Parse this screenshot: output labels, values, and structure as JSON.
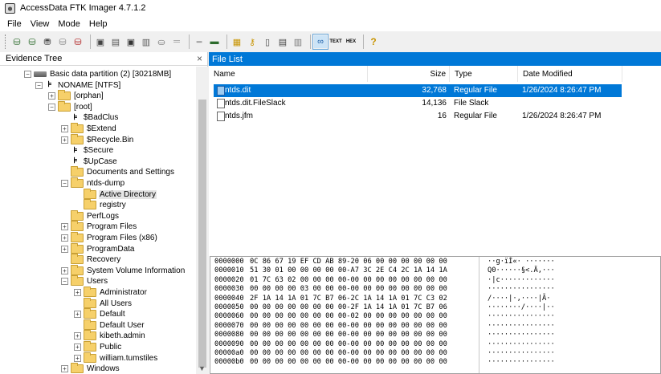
{
  "window": {
    "title": "AccessData FTK Imager 4.7.1.2"
  },
  "menu": [
    "File",
    "View",
    "Mode",
    "Help"
  ],
  "toolbar": {
    "icons": [
      "add-evidence-icon",
      "add-all-evidence-icon",
      "image-mounting-icon",
      "remove-evidence-icon",
      "remove-all-evidence-icon",
      "create-disk-image-icon",
      "export-disk-image-icon",
      "export-logical-image-icon",
      "add-to-custom-image-icon",
      "create-custom-image-icon",
      "decrypt-icon",
      "verify-drive-icon",
      "capture-memory-icon",
      "obtain-protected-files-icon",
      "detect-encryption-icon",
      "export-files-icon",
      "export-hash-list-icon",
      "export-directory-listing-icon",
      "auto-view-icon",
      "text-view-icon",
      "hex-view-icon",
      "help-icon"
    ],
    "text_label": "TEXT",
    "hex_label": "HEX",
    "help_label": "?"
  },
  "evidence_tree": {
    "title": "Evidence Tree",
    "close": "×",
    "nodes": [
      {
        "label": "Basic data partition (2) [30218MB]",
        "type": "partition",
        "expander": "⊟"
      },
      {
        "label": "NONAME [NTFS]",
        "type": "volume",
        "expander": "⊟"
      },
      {
        "label": "[orphan]",
        "type": "folder",
        "expander": "⊞"
      },
      {
        "label": "[root]",
        "type": "folder",
        "expander": "⊟"
      },
      {
        "label": "$BadClus",
        "type": "special",
        "expander": ""
      },
      {
        "label": "$Extend",
        "type": "folder",
        "expander": "⊞"
      },
      {
        "label": "$Recycle.Bin",
        "type": "folder",
        "expander": "⊞"
      },
      {
        "label": "$Secure",
        "type": "special",
        "expander": ""
      },
      {
        "label": "$UpCase",
        "type": "special",
        "expander": ""
      },
      {
        "label": "Documents and Settings",
        "type": "folder",
        "expander": ""
      },
      {
        "label": "ntds-dump",
        "type": "folder",
        "expander": "⊟"
      },
      {
        "label": "Active Directory",
        "type": "folder",
        "expander": ""
      },
      {
        "label": "registry",
        "type": "folder",
        "expander": ""
      },
      {
        "label": "PerfLogs",
        "type": "folder",
        "expander": ""
      },
      {
        "label": "Program Files",
        "type": "folder",
        "expander": "⊞"
      },
      {
        "label": "Program Files (x86)",
        "type": "folder",
        "expander": "⊞"
      },
      {
        "label": "ProgramData",
        "type": "folder",
        "expander": "⊞"
      },
      {
        "label": "Recovery",
        "type": "folder",
        "expander": ""
      },
      {
        "label": "System Volume Information",
        "type": "folder",
        "expander": "⊞"
      },
      {
        "label": "Users",
        "type": "folder",
        "expander": "⊟"
      },
      {
        "label": "Administrator",
        "type": "folder",
        "expander": "⊞"
      },
      {
        "label": "All Users",
        "type": "folder",
        "expander": ""
      },
      {
        "label": "Default",
        "type": "folder",
        "expander": "⊞"
      },
      {
        "label": "Default User",
        "type": "folder",
        "expander": ""
      },
      {
        "label": "kibeth.admin",
        "type": "folder",
        "expander": "⊞"
      },
      {
        "label": "Public",
        "type": "folder",
        "expander": "⊞"
      },
      {
        "label": "william.tumstiles",
        "type": "folder",
        "expander": "⊞"
      },
      {
        "label": "Windows",
        "type": "folder",
        "expander": "⊞"
      }
    ],
    "selected": "Active Directory"
  },
  "file_list": {
    "title": "File List",
    "columns": {
      "name": "Name",
      "size": "Size",
      "type": "Type",
      "modified": "Date Modified"
    },
    "rows": [
      {
        "name": "ntds.dit",
        "size": "32,768",
        "type": "Regular File",
        "modified": "1/26/2024 8:26:47 PM",
        "selected": true
      },
      {
        "name": "ntds.dit.FileSlack",
        "size": "14,136",
        "type": "File Slack",
        "modified": "",
        "selected": false
      },
      {
        "name": "ntds.jfm",
        "size": "16",
        "type": "Regular File",
        "modified": "1/26/2024 8:26:47 PM",
        "selected": false
      }
    ]
  },
  "hex_view": {
    "lines": [
      {
        "offset": "0000000",
        "bytes": "0C 86 67 19 EF CD AB 89-20 06 00 00 00 00 00 00",
        "ascii": "··g·ïÍ«· ·······"
      },
      {
        "offset": "0000010",
        "bytes": "51 30 01 00 00 00 00 00-A7 3C 2E C4 2C 1A 14 1A",
        "ascii": "Q0······§<.Ä,···"
      },
      {
        "offset": "0000020",
        "bytes": "01 7C 63 02 00 00 00 00-00 00 00 00 00 00 00 00",
        "ascii": "·|c·············"
      },
      {
        "offset": "0000030",
        "bytes": "00 00 00 00 03 00 00 00-00 00 00 00 00 00 00 00",
        "ascii": "················"
      },
      {
        "offset": "0000040",
        "bytes": "2F 1A 14 1A 01 7C B7 06-2C 1A 14 1A 01 7C C3 02",
        "ascii": "/····|·,····|Ã·"
      },
      {
        "offset": "0000050",
        "bytes": "00 00 00 00 00 00 00 00-2F 1A 14 1A 01 7C B7 06",
        "ascii": "········/····|··"
      },
      {
        "offset": "0000060",
        "bytes": "00 00 00 00 00 00 00 00-02 00 00 00 00 00 00 00",
        "ascii": "················"
      },
      {
        "offset": "0000070",
        "bytes": "00 00 00 00 00 00 00 00-00 00 00 00 00 00 00 00",
        "ascii": "················"
      },
      {
        "offset": "0000080",
        "bytes": "00 00 00 00 00 00 00 00-00 00 00 00 00 00 00 00",
        "ascii": "················"
      },
      {
        "offset": "0000090",
        "bytes": "00 00 00 00 00 00 00 00-00 00 00 00 00 00 00 00",
        "ascii": "················"
      },
      {
        "offset": "00000a0",
        "bytes": "00 00 00 00 00 00 00 00-00 00 00 00 00 00 00 00",
        "ascii": "················"
      },
      {
        "offset": "00000b0",
        "bytes": "00 00 00 00 00 00 00 00-00 00 00 00 00 00 00 00",
        "ascii": "················"
      }
    ]
  },
  "colors": {
    "accent": "#0078d7",
    "folder": "#f6d06a",
    "background": "#f0f0f0"
  }
}
